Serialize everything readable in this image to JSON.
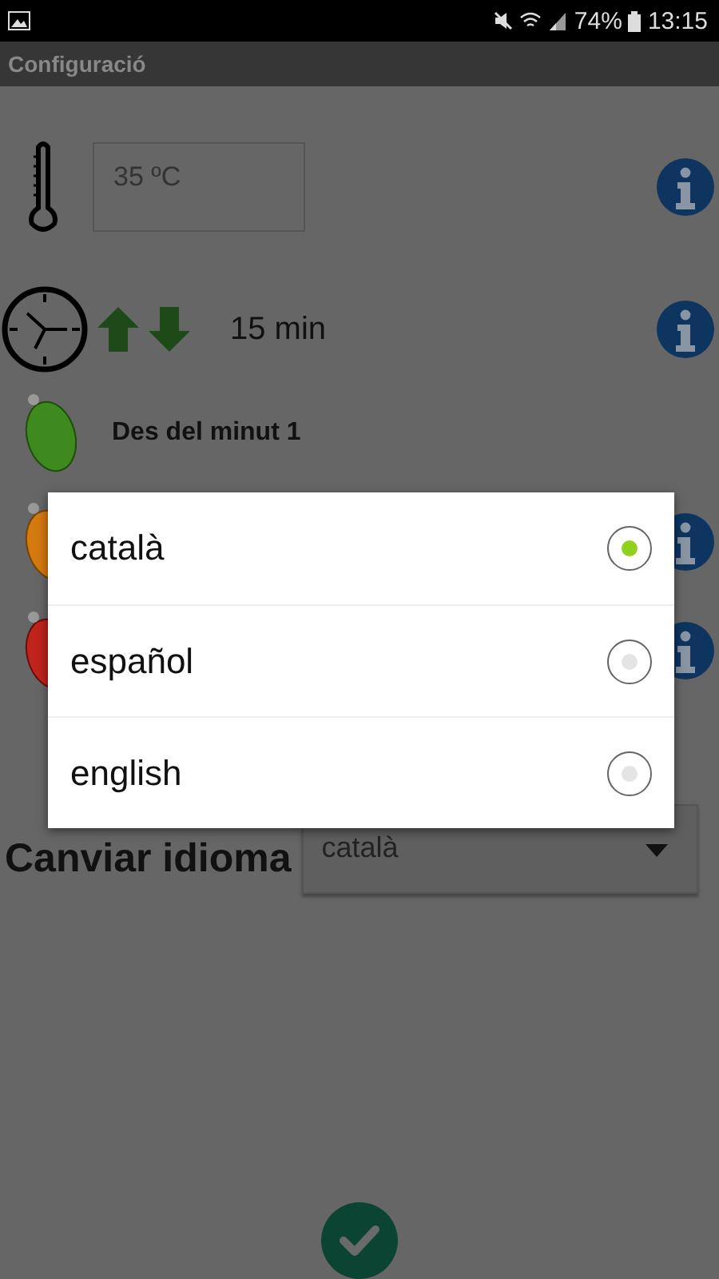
{
  "status_bar": {
    "battery": "74%",
    "time": "13:15"
  },
  "app_bar": {
    "title": "Configuració"
  },
  "temperature": {
    "value": "35 ºC"
  },
  "interval": {
    "value": "15 min"
  },
  "lights": [
    {
      "kind": "green",
      "label": "Des del minut 1"
    },
    {
      "kind": "orange"
    },
    {
      "kind": "red"
    }
  ],
  "language": {
    "label": "Canviar idioma",
    "value": "català"
  },
  "dialog": {
    "options": [
      {
        "label": "català",
        "selected": true
      },
      {
        "label": "español",
        "selected": false
      },
      {
        "label": "english",
        "selected": false
      }
    ]
  }
}
